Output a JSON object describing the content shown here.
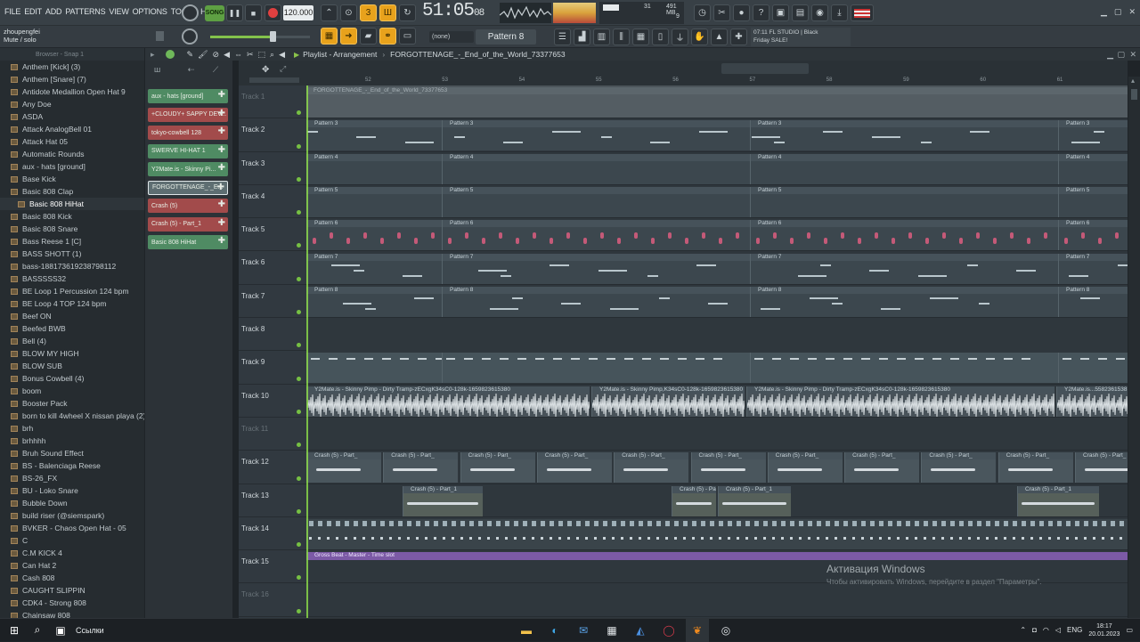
{
  "menu": [
    "FILE",
    "EDIT",
    "ADD",
    "PATTERNS",
    "VIEW",
    "OPTIONS",
    "TOOLS",
    "HELP"
  ],
  "transport": {
    "mode": "SONG",
    "bpm": "120.000",
    "time": "51:05",
    "time_sub": "08",
    "cpu": "31",
    "mem": "491 MB",
    "poly": "9"
  },
  "hint": {
    "user": "zhoupengfei",
    "action": "Mute / solo"
  },
  "pattern_label": "Pattern 8",
  "snap_none": "(none)",
  "news": {
    "line1": "07:11  FL STUDIO | Black",
    "line2": "Friday SALE!"
  },
  "browser_title": "Browser - Snap 1",
  "playlist_title": "Playlist - Arrangement",
  "playlist_song": "FORGOTTENAGE_-_End_of_the_World_73377653",
  "browser_items": [
    "Anthem [Kick] (3)",
    "Anthem [Snare] (7)",
    "Antidote Medallion Open Hat 9",
    "Any Doe",
    "ASDA",
    "Attack AnalogBell 01",
    "Attack Hat 05",
    "Automatic Rounds",
    "aux - hats [ground]",
    "Base Kick",
    "Basic 808 Clap",
    "Basic 808 HiHat",
    "Basic 808 Kick",
    "Basic 808 Snare",
    "Bass Reese 1 [C]",
    "BASS SHOTT (1)",
    "bass-188173619238798112",
    "BASSSSS32",
    "BE Loop 1 Percussion 124 bpm",
    "BE Loop 4 TOP 124 bpm",
    "Beef ON",
    "Beefed BWB",
    "Bell (4)",
    "BLOW MY HIGH",
    "BLOW SUB",
    "Bonus Cowbell (4)",
    "boom",
    "Booster Pack",
    "born to kill 4wheel X nissan playa (2)",
    "brh",
    "brhhhh",
    "Bruh Sound Effect",
    "BS - Balenciaga Reese",
    "BS-26_FX",
    "BU - Loko Snare",
    "Bubble Down",
    "build riser (@siemspark)",
    "BVKER - Chaos Open Hat - 05",
    "C",
    "C.M KICK 4",
    "Can Hat 2",
    "Cash 808",
    "CAUGHT SLIPPIN",
    "CDK4 - Strong 808",
    "Chainsaw 808"
  ],
  "channels": [
    "aux - hats [ground]",
    "+CLOUDY+ SAPPY DEV...",
    "tokyo-cowbell 128",
    "SWERVE HI-HAT 1",
    "Y2Mate.is - Skinny Pi...",
    "FORGOTTENAGE_-_E...",
    "Crash (5)",
    "Crash (5) - Part_1",
    "Basic 808 HiHat"
  ],
  "tracks": [
    "Track 1",
    "Track 2",
    "Track 3",
    "Track 4",
    "Track 5",
    "Track 6",
    "Track 7",
    "Track 8",
    "Track 9",
    "Track 10",
    "Track 11",
    "Track 12",
    "Track 13",
    "Track 14",
    "Track 15",
    "Track 16"
  ],
  "ruler": [
    "52",
    "53",
    "54",
    "55",
    "56",
    "57",
    "58",
    "59",
    "60",
    "61"
  ],
  "clips": {
    "top": "FORGOTTENAGE_-_End_of_the_World_73377653",
    "p3": "Pattern 3",
    "p4": "Pattern 4",
    "p5": "Pattern 5",
    "p6": "Pattern 6",
    "p7": "Pattern 7",
    "p8": "Pattern 8",
    "y2a": "Y2Mate.is - Skinny Pimp - Dirty Tramp-zECxgK34sC0-128k-1659823615380",
    "y2b": "Y2Mate.is - Skinny Pimp,K34sC0-128k-1659823615380",
    "y2c": "Y2Mate.is - Skinny Pimp - Dirty Tramp-zECxgK34sC0-128k-1659823615380",
    "y2d": "Y2Mate.is...5582361538",
    "crash_short": "Crash (5) - Part_",
    "crash": "Crash (5) - Part_1",
    "gross": "Gross Beat - Master - Time slot"
  },
  "watermark": {
    "title": "Активация Windows",
    "sub": "Чтобы активировать Windows, перейдите в раздел \"Параметры\"."
  },
  "taskbar": {
    "search": "Ссылки",
    "lang": "ENG",
    "clock": "18:17",
    "date": "20.01.2023"
  },
  "colors": {
    "accent": "#e8a21c",
    "chan_green": "#4f8b63",
    "chan_red": "#a24b4b",
    "clip_purple": "#7c5aa6"
  }
}
